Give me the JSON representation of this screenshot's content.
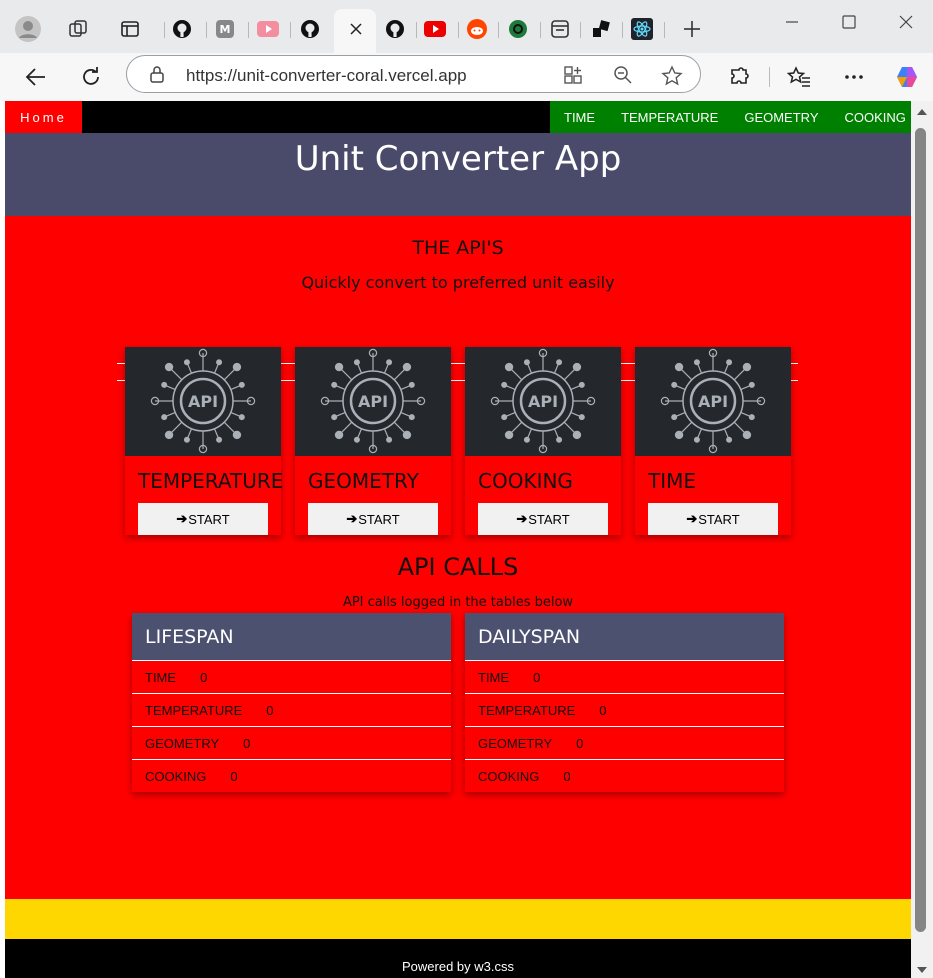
{
  "browser": {
    "url": "https://unit-converter-coral.vercel.app",
    "tab_icons": [
      "profile-avatar-icon",
      "workspaces-icon",
      "vertical-tabs-icon",
      "github-favicon",
      "medium-favicon",
      "youtube-favicon",
      "github-favicon",
      "close-tab-icon",
      "github-favicon",
      "youtube-favicon",
      "reddit-favicon",
      "chatgpt-favicon",
      "app-favicon",
      "dev-favicon",
      "react-favicon",
      "new-tab-icon"
    ]
  },
  "nav": {
    "home": "Home",
    "menu": [
      "TIME",
      "TEMPERATURE",
      "GEOMETRY",
      "COOKING"
    ]
  },
  "header": {
    "title": "Unit Converter App"
  },
  "apis": {
    "heading": "THE API'S",
    "subheading": "Quickly convert to preferred unit easily",
    "image_text": "API",
    "cards": [
      {
        "title": "TEMPERATURE",
        "button": "START"
      },
      {
        "title": "GEOMETRY",
        "button": "START"
      },
      {
        "title": "COOKING",
        "button": "START"
      },
      {
        "title": "TIME",
        "button": "START"
      }
    ]
  },
  "calls": {
    "heading": "API CALLS",
    "subheading": "API calls logged in the tables below",
    "tables": [
      {
        "title": "LIFESPAN",
        "rows": [
          {
            "label": "TIME",
            "value": "0"
          },
          {
            "label": "TEMPERATURE",
            "value": "0"
          },
          {
            "label": "GEOMETRY",
            "value": "0"
          },
          {
            "label": "COOKING",
            "value": "0"
          }
        ]
      },
      {
        "title": "DAILYSPAN",
        "rows": [
          {
            "label": "TIME",
            "value": "0"
          },
          {
            "label": "TEMPERATURE",
            "value": "0"
          },
          {
            "label": "GEOMETRY",
            "value": "0"
          },
          {
            "label": "COOKING",
            "value": "0"
          }
        ]
      }
    ]
  },
  "footer": {
    "text": "Powered by w3.css"
  },
  "colors": {
    "page_bg": "#ff0000",
    "header_bg": "#4a4a6a",
    "menu_bg": "#008000",
    "band": "#ffd700",
    "footer_bg": "#000000"
  }
}
